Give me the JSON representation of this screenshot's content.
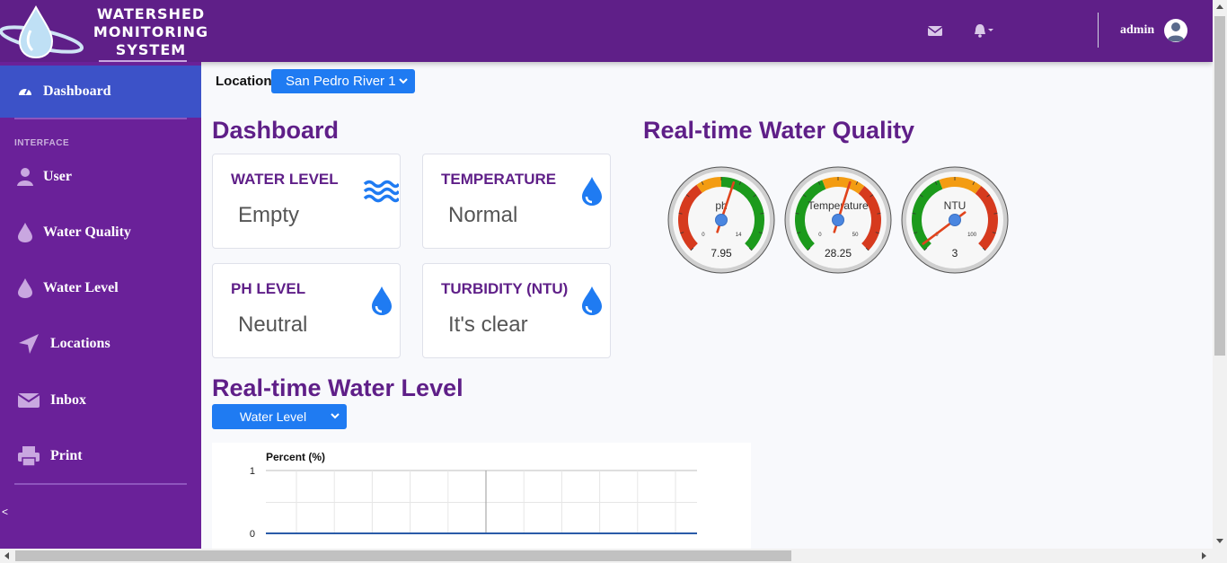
{
  "brand": {
    "lines": [
      "WATERSHED",
      "MONITORING",
      "SYSTEM"
    ]
  },
  "topbar": {
    "user_name": "admin"
  },
  "sidebar": {
    "active": "Dashboard",
    "heading": "INTERFACE",
    "items": [
      "User",
      "Water Quality",
      "Water Level",
      "Locations",
      "Inbox",
      "Print"
    ],
    "toggle": "<"
  },
  "location": {
    "label": "Location",
    "selected": "San Pedro River 1"
  },
  "dashboard": {
    "title": "Dashboard",
    "cards": [
      {
        "title": "WATER LEVEL",
        "value": "Empty",
        "icon": "water-waves-icon"
      },
      {
        "title": "TEMPERATURE",
        "value": "Normal",
        "icon": "water-drop-icon"
      },
      {
        "title": "PH LEVEL",
        "value": "Neutral",
        "icon": "water-drop-icon"
      },
      {
        "title": "TURBIDITY (NTU)",
        "value": "It's clear",
        "icon": "water-drop-icon"
      }
    ]
  },
  "quality": {
    "title": "Real-time Water Quality",
    "gauges": [
      {
        "label": "ph",
        "value": 7.95,
        "display": "7.95",
        "min": 0,
        "max": 14,
        "min_label": "0",
        "max_label": "14"
      },
      {
        "label": "Temperature",
        "value": 28.25,
        "display": "28.25",
        "min": 0,
        "max": 50,
        "min_label": "0",
        "max_label": "50"
      },
      {
        "label": "NTU",
        "value": 3,
        "display": "3",
        "min": 0,
        "max": 100,
        "min_label": "0",
        "max_label": "100"
      }
    ]
  },
  "level": {
    "title": "Real-time Water Level",
    "selected": "Water Level"
  },
  "chart_data": {
    "type": "line",
    "ylabel": "Percent (%)",
    "y_ticks": [
      "1",
      "0"
    ],
    "ylim": [
      0,
      1
    ],
    "series": [
      {
        "values": [
          0,
          0,
          0,
          0,
          0,
          0,
          0,
          0,
          0,
          0,
          0,
          0
        ]
      }
    ]
  },
  "colors": {
    "primary": "#5f1f88",
    "sidebar": "#6a2199",
    "active": "#3c52c8",
    "accent": "#1f7bf2"
  }
}
